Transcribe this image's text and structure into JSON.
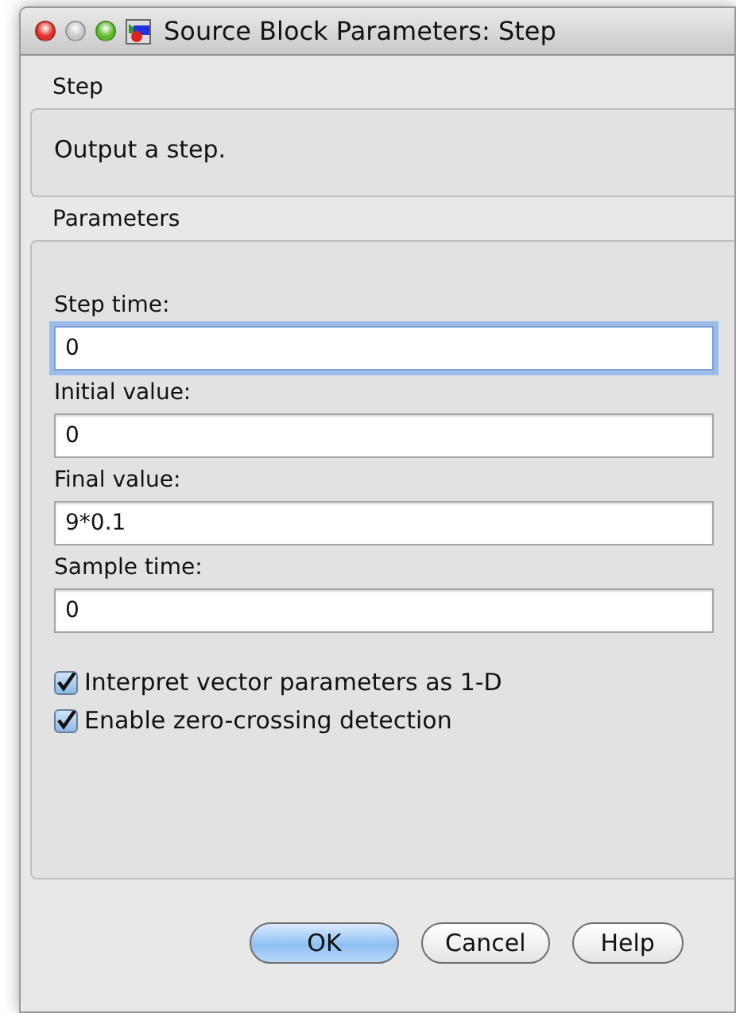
{
  "window": {
    "title": "Source Block Parameters: Step"
  },
  "block": {
    "heading": "Step",
    "description": "Output a step."
  },
  "parameters": {
    "heading": "Parameters",
    "fields": [
      {
        "label": "Step time:",
        "value": "0",
        "focused": true
      },
      {
        "label": "Initial value:",
        "value": "0",
        "focused": false
      },
      {
        "label": "Final value:",
        "value": "9*0.1",
        "focused": false
      },
      {
        "label": "Sample time:",
        "value": "0",
        "focused": false
      }
    ],
    "checkboxes": [
      {
        "label": "Interpret vector parameters as 1-D",
        "checked": true
      },
      {
        "label": "Enable zero-crossing detection",
        "checked": true
      }
    ]
  },
  "buttons": [
    {
      "label": "OK",
      "default": true
    },
    {
      "label": "Cancel",
      "default": false
    },
    {
      "label": "Help",
      "default": false
    }
  ]
}
